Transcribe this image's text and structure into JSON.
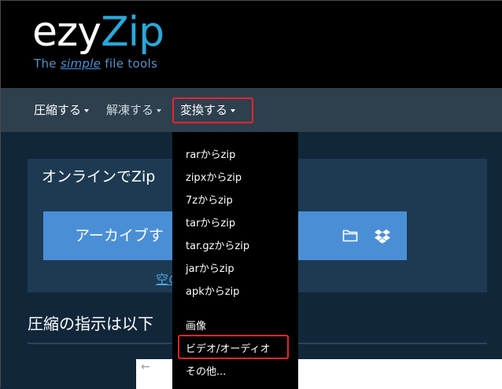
{
  "logo": {
    "word_part1": "ezy",
    "word_part2": "Zip",
    "tag_before": "The ",
    "tag_simple": "simple",
    "tag_after": " file tools"
  },
  "nav": {
    "items": [
      {
        "label": "圧縮する"
      },
      {
        "label": "解凍する"
      },
      {
        "label": "変換する"
      }
    ]
  },
  "main": {
    "panel_title": "オンラインでZip",
    "archive_button_label": "アーカイブす",
    "blank_link": "空の",
    "section_title": "圧縮の指示は以下"
  },
  "ad": {
    "arrow": "←"
  },
  "dropdown": {
    "items": [
      {
        "label": "rarからzip"
      },
      {
        "label": "zipxからzip"
      },
      {
        "label": "7zからzip"
      },
      {
        "label": "tarからzip"
      },
      {
        "label": "tar.gzからzip"
      },
      {
        "label": "jarからzip"
      },
      {
        "label": "apkからzip"
      },
      {
        "label": "画像"
      },
      {
        "label": "ビデオ/オーディオ"
      },
      {
        "label": "その他..."
      }
    ]
  },
  "colors": {
    "highlight": "#e5262d",
    "brand_blue": "#2aa7d9",
    "button_blue": "#4a8fd6"
  },
  "icons": [
    "folder-icon",
    "dropbox-icon",
    "caret-down-icon"
  ]
}
